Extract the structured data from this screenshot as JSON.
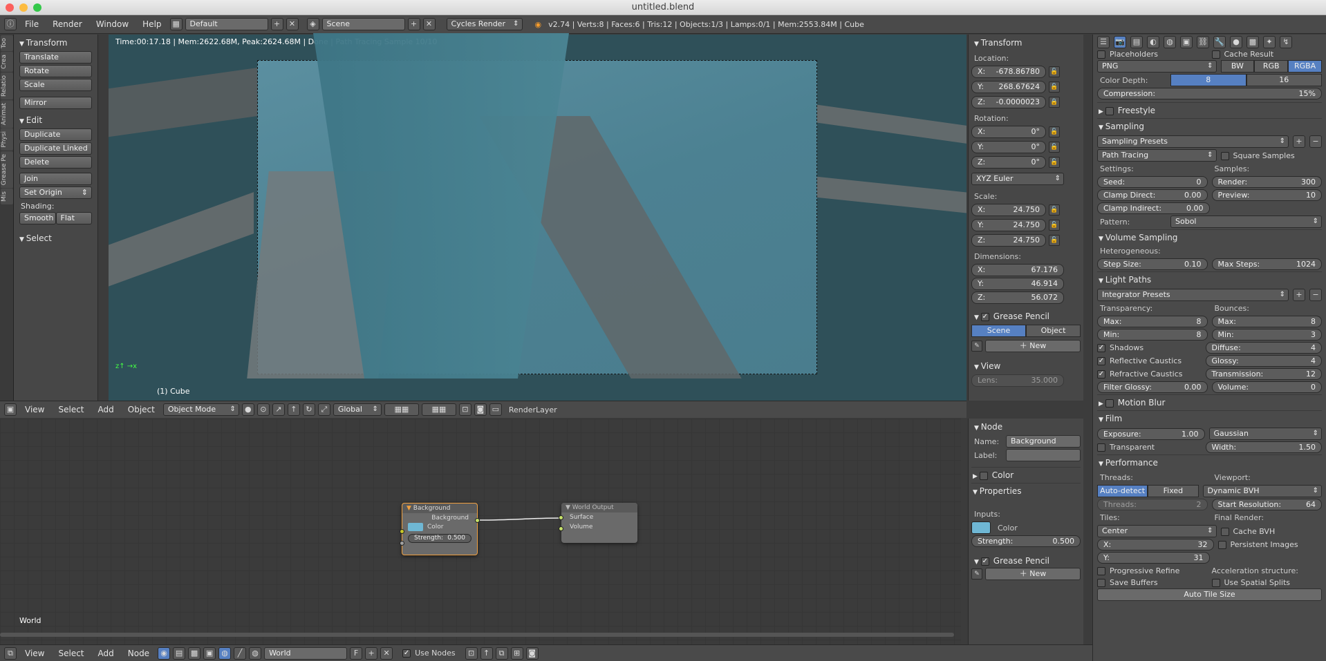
{
  "window": {
    "title": "untitled.blend"
  },
  "topbar": {
    "menus": [
      "File",
      "Render",
      "Window",
      "Help"
    ],
    "layout": "Default",
    "scene": "Scene",
    "engine": "Cycles Render",
    "stats": "v2.74 | Verts:8 | Faces:6 | Tris:12 | Objects:1/3 | Lamps:0/1 | Mem:2553.84M | Cube"
  },
  "tabs": [
    "Too",
    "Crea",
    "Relatio",
    "Animat",
    "Physi",
    "Grease Pe",
    "Mis"
  ],
  "tools": {
    "transform_title": "Transform",
    "translate": "Translate",
    "rotate": "Rotate",
    "scale": "Scale",
    "mirror": "Mirror",
    "edit_title": "Edit",
    "duplicate": "Duplicate",
    "duplicate_linked": "Duplicate Linked",
    "delete": "Delete",
    "join": "Join",
    "set_origin": "Set Origin",
    "shading_label": "Shading:",
    "smooth": "Smooth",
    "flat": "Flat",
    "select_title": "Select"
  },
  "viewport": {
    "render_info": "Time:00:17.18 | Mem:2622.68M, Peak:2624.68M | Done | Path Tracing Sample 10/10",
    "object_label": "(1) Cube"
  },
  "npanel": {
    "transform_title": "Transform",
    "location_label": "Location:",
    "loc": [
      "X:",
      "-678.86780",
      "Y:",
      "268.67624",
      "Z:",
      "-0.0000023"
    ],
    "rotation_label": "Rotation:",
    "rot": [
      "X:",
      "0°",
      "Y:",
      "0°",
      "Z:",
      "0°"
    ],
    "rot_mode": "XYZ Euler",
    "scale_label": "Scale:",
    "scl": [
      "X:",
      "24.750",
      "Y:",
      "24.750",
      "Z:",
      "24.750"
    ],
    "dimensions_label": "Dimensions:",
    "dim": [
      "X:",
      "67.176",
      "Y:",
      "46.914",
      "Z:",
      "56.072"
    ],
    "grease_title": "Grease Pencil",
    "scene_btn": "Scene",
    "object_btn": "Object",
    "new_btn": "New",
    "view_title": "View",
    "lens_label": "Lens:",
    "lens_value": "35.000"
  },
  "vhead": {
    "view": "View",
    "select": "Select",
    "add": "Add",
    "object": "Object",
    "mode": "Object Mode",
    "orient": "Global",
    "layer": "RenderLayer"
  },
  "nodes": {
    "bg_title": "Background",
    "bg_out": "Background",
    "bg_color": "Color",
    "bg_strength_label": "Strength:",
    "bg_strength": "0.500",
    "wo_title": "World Output",
    "wo_surface": "Surface",
    "wo_volume": "Volume",
    "world_label": "World"
  },
  "nodepanel": {
    "node_title": "Node",
    "name_label": "Name:",
    "name_value": "Background",
    "label_label": "Label:",
    "color_title": "Color",
    "properties_title": "Properties",
    "inputs_label": "Inputs:",
    "color_label": "Color",
    "strength_label": "Strength:",
    "strength_value": "0.500",
    "grease_title": "Grease Pencil",
    "new_btn": "New"
  },
  "nhead": {
    "view": "View",
    "select": "Select",
    "add": "Add",
    "node": "Node",
    "world": "World",
    "f": "F",
    "use_nodes": "Use Nodes"
  },
  "props": {
    "placeholders": "Placeholders",
    "cache_result": "Cache Result",
    "format": "PNG",
    "bw": "BW",
    "rgb": "RGB",
    "rgba": "RGBA",
    "color_depth_label": "Color Depth:",
    "depth_8": "8",
    "depth_16": "16",
    "compression_label": "Compression:",
    "compression": "15%",
    "freestyle": "Freestyle",
    "sampling": "Sampling",
    "sampling_presets": "Sampling Presets",
    "path_tracing": "Path Tracing",
    "square_samples": "Square Samples",
    "settings_label": "Settings:",
    "samples_label": "Samples:",
    "seed_label": "Seed:",
    "seed": "0",
    "render_label": "Render:",
    "render": "300",
    "clamp_direct_label": "Clamp Direct:",
    "clamp_direct": "0.00",
    "preview_label": "Preview:",
    "preview": "10",
    "clamp_indirect_label": "Clamp Indirect:",
    "clamp_indirect": "0.00",
    "pattern_label": "Pattern:",
    "pattern": "Sobol",
    "volume_sampling": "Volume Sampling",
    "heterogeneous": "Heterogeneous:",
    "step_size_label": "Step Size:",
    "step_size": "0.10",
    "max_steps_label": "Max Steps:",
    "max_steps": "1024",
    "light_paths": "Light Paths",
    "integrator_presets": "Integrator Presets",
    "transparency_label": "Transparency:",
    "bounces_label": "Bounces:",
    "t_max_label": "Max:",
    "t_max": "8",
    "b_max_label": "Max:",
    "b_max": "8",
    "t_min_label": "Min:",
    "t_min": "8",
    "b_min_label": "Min:",
    "b_min": "3",
    "shadows": "Shadows",
    "diffuse_label": "Diffuse:",
    "diffuse": "4",
    "glossy_label": "Glossy:",
    "glossy": "4",
    "reflective_caustics": "Reflective Caustics",
    "transmission_label": "Transmission:",
    "transmission": "12",
    "refractive_caustics": "Refractive Caustics",
    "volume_label": "Volume:",
    "volume": "0",
    "filter_glossy_label": "Filter Glossy:",
    "filter_glossy": "0.00",
    "motion_blur": "Motion Blur",
    "film": "Film",
    "exposure_label": "Exposure:",
    "exposure": "1.00",
    "filter": "Gaussian",
    "transparent": "Transparent",
    "width_label": "Width:",
    "width": "1.50",
    "performance": "Performance",
    "threads_label": "Threads:",
    "viewport_label": "Viewport:",
    "auto_detect": "Auto-detect",
    "fixed": "Fixed",
    "bvh": "Dynamic BVH",
    "threads_field_label": "Threads:",
    "threads_field": "2",
    "start_res_label": "Start Resolution:",
    "start_res": "64",
    "tiles_label": "Tiles:",
    "tiles": "Center",
    "final_render": "Final Render:",
    "tx_label": "X:",
    "tx": "32",
    "cache_bvh": "Cache BVH",
    "ty_label": "Y:",
    "ty": "31",
    "persistent": "Persistent Images",
    "progressive": "Progressive Refine",
    "accel": "Acceleration structure:",
    "save_buffers": "Save Buffers",
    "spatial_splits": "Use Spatial Splits",
    "auto_tile": "Auto Tile Size"
  },
  "colors": {
    "accent": "#5680c2",
    "viewport_bg": "#2f5059",
    "node_bg": "#3b3b3b",
    "socket": "#c7e36a",
    "swatch": "#6fb7d4"
  }
}
